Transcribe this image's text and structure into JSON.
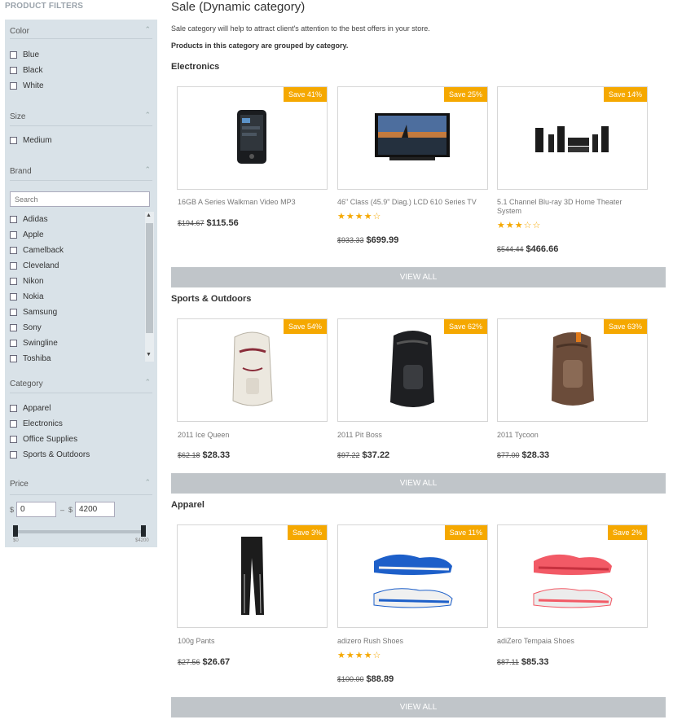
{
  "sidebar": {
    "title": "PRODUCT FILTERS",
    "color": {
      "heading": "Color",
      "options": [
        "Blue",
        "Black",
        "White"
      ]
    },
    "size": {
      "heading": "Size",
      "options": [
        "Medium"
      ]
    },
    "brand": {
      "heading": "Brand",
      "search_placeholder": "Search",
      "options": [
        "Adidas",
        "Apple",
        "Camelback",
        "Cleveland",
        "Nikon",
        "Nokia",
        "Samsung",
        "Sony",
        "Swingline",
        "Toshiba"
      ]
    },
    "category": {
      "heading": "Category",
      "options": [
        "Apparel",
        "Electronics",
        "Office Supplies",
        "Sports & Outdoors"
      ]
    },
    "price": {
      "heading": "Price",
      "currency": "$",
      "separator": "–",
      "min_value": "0",
      "max_value": "4200",
      "min_label": "$0",
      "max_label": "$4200"
    }
  },
  "main": {
    "title": "Sale (Dynamic category)",
    "description": "Sale category will help to attract client's attention to the best offers in your store.",
    "note": "Products in this category are grouped by category.",
    "view_all_label": "VIEW ALL",
    "categories": [
      {
        "name": "Electronics",
        "products": [
          {
            "name": "16GB A Series Walkman Video MP3",
            "badge": "Save 41%",
            "old_price": "$194.67",
            "price": "$115.56",
            "rating": 0,
            "image": "mp3-player-image"
          },
          {
            "name": "46\" Class (45.9\" Diag.) LCD 610 Series TV",
            "badge": "Save 25%",
            "old_price": "$933.33",
            "price": "$699.99",
            "rating": 4,
            "image": "tv-image"
          },
          {
            "name": "5.1 Channel Blu-ray 3D Home Theater System",
            "badge": "Save 14%",
            "old_price": "$544.44",
            "price": "$466.66",
            "rating": 3,
            "image": "home-theater-image"
          }
        ]
      },
      {
        "name": "Sports & Outdoors",
        "products": [
          {
            "name": "2011 Ice Queen",
            "badge": "Save 54%",
            "old_price": "$62.18",
            "price": "$28.33",
            "rating": 0,
            "image": "white-backpack-image"
          },
          {
            "name": "2011 Pit Boss",
            "badge": "Save 62%",
            "old_price": "$97.22",
            "price": "$37.22",
            "rating": 0,
            "image": "black-backpack-image"
          },
          {
            "name": "2011 Tycoon",
            "badge": "Save 63%",
            "old_price": "$77.00",
            "price": "$28.33",
            "rating": 0,
            "image": "brown-backpack-image"
          }
        ]
      },
      {
        "name": "Apparel",
        "products": [
          {
            "name": "100g Pants",
            "badge": "Save 3%",
            "old_price": "$27.56",
            "price": "$26.67",
            "rating": 0,
            "image": "pants-image"
          },
          {
            "name": "adizero Rush Shoes",
            "badge": "Save 11%",
            "old_price": "$100.00",
            "price": "$88.89",
            "rating": 4,
            "image": "blue-shoes-image"
          },
          {
            "name": "adiZero Tempaia Shoes",
            "badge": "Save 2%",
            "old_price": "$87.11",
            "price": "$85.33",
            "rating": 0,
            "image": "pink-shoes-image"
          }
        ]
      }
    ]
  },
  "colors": {
    "badge": "#f5a800",
    "star": "#f5a800",
    "view_all_bg": "#c0c5c9",
    "sidebar_bg": "#d9e2e8"
  }
}
